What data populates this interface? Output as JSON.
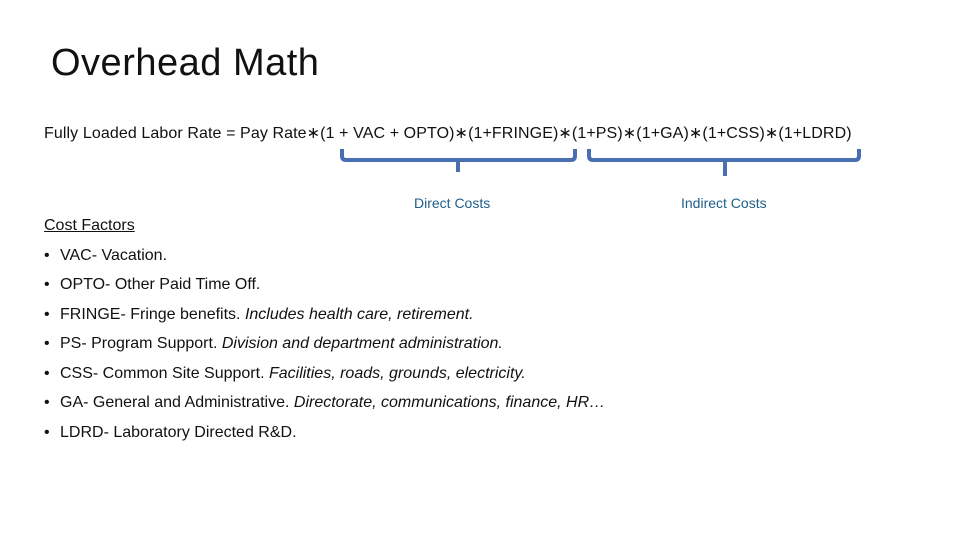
{
  "slide": {
    "title": "Overhead Math",
    "formula": "Fully Loaded Labor Rate = Pay Rate∗(1 + VAC + OPTO)∗(1+FRINGE)∗(1+PS)∗(1+GA)∗(1+CSS)∗(1+LDRD)",
    "brackets": {
      "direct_label": "Direct Costs",
      "indirect_label": "Indirect Costs",
      "color": "#4a6fb0",
      "label_color": "#1f5f8b"
    },
    "cost_factors": {
      "heading": "Cost Factors",
      "bullet": "•",
      "items": [
        {
          "term": "VAC- Vacation.",
          "description": ""
        },
        {
          "term": "OPTO- Other Paid Time Off.",
          "description": ""
        },
        {
          "term": "FRINGE- Fringe benefits. ",
          "description": "Includes health care, retirement."
        },
        {
          "term": "PS- Program Support. ",
          "description": "Division and department administration."
        },
        {
          "term": "CSS- Common Site Support. ",
          "description": "Facilities, roads, grounds, electricity."
        },
        {
          "term": "GA- General and Administrative. ",
          "description": "Directorate, communications, finance, HR…"
        },
        {
          "term": "LDRD- Laboratory Directed R&D.",
          "description": ""
        }
      ]
    }
  }
}
